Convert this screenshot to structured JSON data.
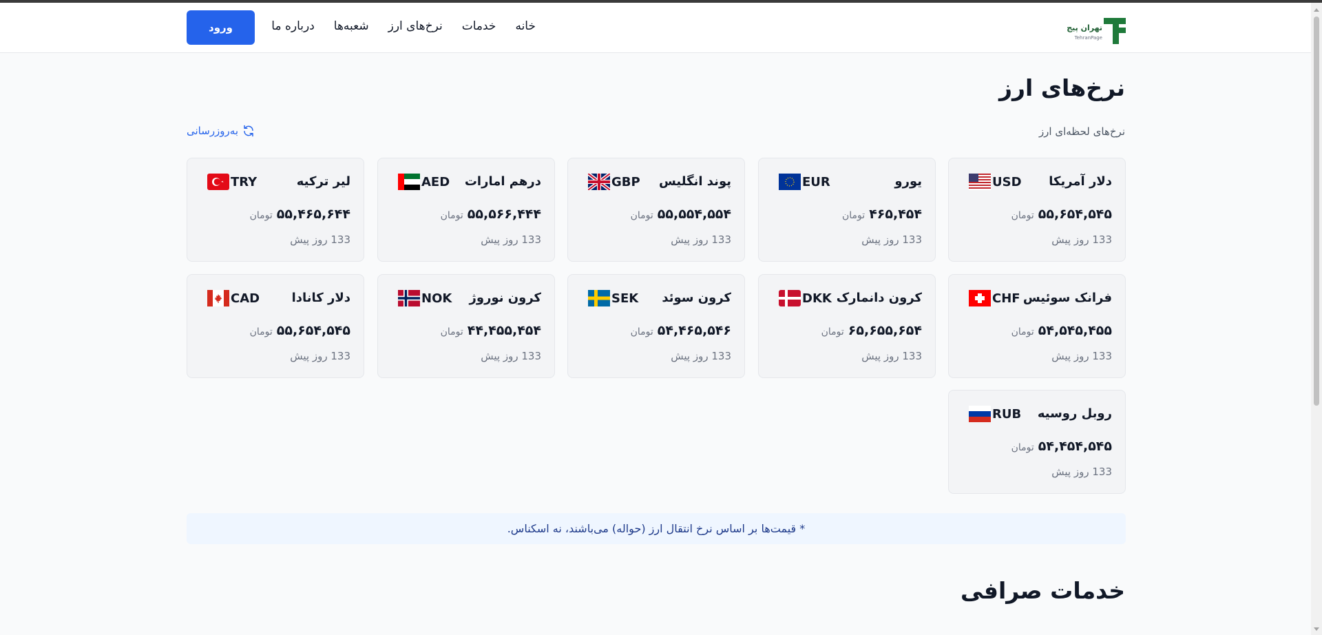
{
  "header": {
    "logo_fa": "تهران پیج",
    "logo_en": "TehranPage",
    "nav": [
      "خانه",
      "خدمات",
      "نرخ‌های ارز",
      "شعبه‌ها",
      "درباره ما"
    ],
    "login_label": "ورود",
    "login_color": "#2563eb"
  },
  "page": {
    "title": "نرخ‌های ارز",
    "subtitle": "نرخ‌های لحظه‌ای ارز",
    "refresh_label": "به‌روزرسانی",
    "refresh_icon": "refresh-icon"
  },
  "rates": [
    {
      "name": "دلار آمریکا",
      "code": "USD",
      "price": "۵۵,۶۵۴,۵۴۵",
      "unit": "تومان",
      "time": "133 روز پیش",
      "flag": "us-flag-icon"
    },
    {
      "name": "یورو",
      "code": "EUR",
      "price": "۴۶۵,۴۵۴",
      "unit": "تومان",
      "time": "133 روز پیش",
      "flag": "eu-flag-icon"
    },
    {
      "name": "پوند انگلیس",
      "code": "GBP",
      "price": "۵۵,۵۵۴,۵۵۴",
      "unit": "تومان",
      "time": "133 روز پیش",
      "flag": "gb-flag-icon"
    },
    {
      "name": "درهم امارات",
      "code": "AED",
      "price": "۵۵,۵۶۶,۴۴۴",
      "unit": "تومان",
      "time": "133 روز پیش",
      "flag": "ae-flag-icon"
    },
    {
      "name": "لیر ترکیه",
      "code": "TRY",
      "price": "۵۵,۴۶۵,۶۴۴",
      "unit": "تومان",
      "time": "133 روز پیش",
      "flag": "tr-flag-icon"
    },
    {
      "name": "فرانک سوئیس",
      "code": "CHF",
      "price": "۵۴,۵۴۵,۴۵۵",
      "unit": "تومان",
      "time": "133 روز پیش",
      "flag": "ch-flag-icon"
    },
    {
      "name": "کرون دانمارک",
      "code": "DKK",
      "price": "۶۵,۶۵۵,۶۵۴",
      "unit": "تومان",
      "time": "133 روز پیش",
      "flag": "dk-flag-icon"
    },
    {
      "name": "کرون سوئد",
      "code": "SEK",
      "price": "۵۴,۴۶۵,۵۴۶",
      "unit": "تومان",
      "time": "133 روز پیش",
      "flag": "se-flag-icon"
    },
    {
      "name": "کرون نوروژ",
      "code": "NOK",
      "price": "۴۴,۴۵۵,۴۵۴",
      "unit": "تومان",
      "time": "133 روز پیش",
      "flag": "no-flag-icon"
    },
    {
      "name": "دلار کانادا",
      "code": "CAD",
      "price": "۵۵,۶۵۴,۵۴۵",
      "unit": "تومان",
      "time": "133 روز پیش",
      "flag": "ca-flag-icon"
    },
    {
      "name": "روبل روسیه",
      "code": "RUB",
      "price": "۵۴,۴۵۴,۵۴۵",
      "unit": "تومان",
      "time": "133 روز پیش",
      "flag": "ru-flag-icon"
    }
  ],
  "note": "* قیمت‌ها بر اساس نرخ انتقال ارز (حواله) می‌باشند، نه اسکناس.",
  "services_title": "خدمات صرافی"
}
